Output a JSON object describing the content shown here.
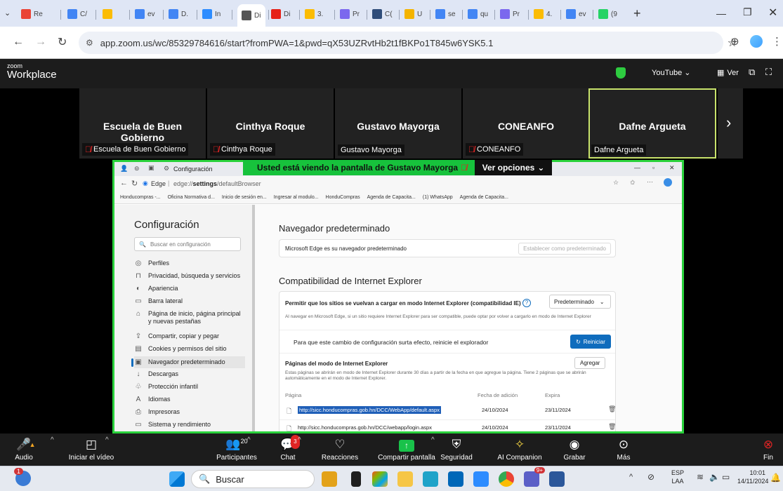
{
  "browser": {
    "tabs": [
      {
        "label": "M",
        "text": "Re",
        "color": "#ea4335"
      },
      {
        "label": "",
        "text": "C/",
        "color": "#4285f4"
      },
      {
        "label": "2.",
        "text": "",
        "color": "#fbbc04"
      },
      {
        "label": "",
        "text": "ev",
        "color": "#4285f4"
      },
      {
        "label": "",
        "text": "D.",
        "color": "#4285f4"
      },
      {
        "label": "zm",
        "text": "In",
        "color": "#2d8cff"
      },
      {
        "label": "",
        "text": "Di",
        "color": "#555"
      },
      {
        "label": "",
        "text": "Di",
        "color": "#e62117"
      },
      {
        "label": "",
        "text": "3.",
        "color": "#fbbc04"
      },
      {
        "label": "",
        "text": "Pr",
        "color": "#7b68ee"
      },
      {
        "label": "",
        "text": "C(",
        "color": "#2f4d7a"
      },
      {
        "label": "",
        "text": "U",
        "color": "#f4b400"
      },
      {
        "label": "G",
        "text": "se",
        "color": "#4285f4"
      },
      {
        "label": "G",
        "text": "qu",
        "color": "#4285f4"
      },
      {
        "label": "",
        "text": "Pr",
        "color": "#7b68ee"
      },
      {
        "label": "",
        "text": "4.",
        "color": "#fbbc04"
      },
      {
        "label": "",
        "text": "ev",
        "color": "#4285f4"
      },
      {
        "label": "",
        "text": "(9",
        "color": "#25d366"
      }
    ],
    "active_tab_close": "×",
    "new_tab": "+",
    "url": "app.zoom.us/wc/85329784616/start?fromPWA=1&pwd=qX53UZRvtHb2t1fBKPo1T845w6YSK5.1"
  },
  "zoom": {
    "logo_small": "zoom",
    "logo_big": "Workplace",
    "youtube_label": "YouTube",
    "view_label": "Ver",
    "participants": [
      {
        "name": "Escuela de Buen Gobierno",
        "label": "Escuela de Buen Gobierno",
        "muted": true
      },
      {
        "name": "Cinthya Roque",
        "label": "Cinthya Roque",
        "muted": true
      },
      {
        "name": "Gustavo Mayorga",
        "label": "Gustavo Mayorga",
        "muted": false
      },
      {
        "name": "CONEANFO",
        "label": "CONEANFO",
        "muted": true
      },
      {
        "name": "Dafne Argueta",
        "label": "Dafne Argueta",
        "muted": false
      }
    ],
    "banner_text": "Usted está viendo la pantalla de  Gustavo Mayorga",
    "view_options": "Ver opciones",
    "toolbar": {
      "audio": "Audio",
      "video": "Iniciar el vídeo",
      "participants": "Participantes",
      "participants_count": "20",
      "chat": "Chat",
      "chat_badge": "3",
      "reactions": "Reacciones",
      "share": "Compartir pantalla",
      "security": "Seguridad",
      "ai": "AI Companion",
      "record": "Grabar",
      "more": "Más",
      "end": "Fin"
    }
  },
  "shared_screen": {
    "window_title": "Configuración",
    "edge_label": "Edge",
    "edge_url_prefix": "edge://",
    "edge_url_bold": "settings",
    "edge_url_suffix": "/defaultBrowser",
    "bookmarks": [
      "Honducompras -...",
      "Oficina Normativa d...",
      "Inicio de sesión en...",
      "Ingresar al modulo...",
      "HonduCompras",
      "Agenda de Capacita...",
      "(1) WhatsApp",
      "Agenda de Capacita..."
    ],
    "sidebar_title": "Configuración",
    "search_placeholder": "Buscar en configuración",
    "sidebar_items": [
      "Perfiles",
      "Privacidad, búsqueda y servicios",
      "Apariencia",
      "Barra lateral",
      "Página de inicio, página principal y nuevas pestañas",
      "Compartir, copiar y pegar",
      "Cookies y permisos del sitio",
      "Navegador predeterminado",
      "Descargas",
      "Protección infantil",
      "Idiomas",
      "Impresoras",
      "Sistema y rendimiento"
    ],
    "default_title": "Navegador predeterminado",
    "default_text": "Microsoft Edge es su navegador predeterminado",
    "default_button": "Establecer como predeterminado",
    "ie_title": "Compatibilidad de Internet Explorer",
    "ie_allow": "Permitir que los sitios se vuelvan a cargar en modo Internet Explorer (compatibilidad IE)",
    "ie_allow_desc": "Al navegar en Microsoft Edge, si un sitio requiere Internet Explorer para ser compatible, puede optar por volver a cargarlo en modo de Internet Explorer",
    "ie_select": "Predeterminado",
    "restart_text": "Para que este cambio de configuración surta efecto, reinicie el explorador",
    "restart_button": "Reiniciar",
    "pages_title": "Páginas del modo de Internet Explorer",
    "pages_desc": "Estas páginas se abrirán en modo de Internet Explorer durante 30 días a partir de la fecha en que agregue la página. Tiene 2 páginas que se abrirán automáticamente en el modo de Internet Explorer.",
    "add_button": "Agregar",
    "col_page": "Página",
    "col_date": "Fecha de adición",
    "col_expires": "Expira",
    "rows": [
      {
        "url": "http://sicc.honducompras.gob.hn/DCC/WebApp/default.aspx",
        "date": "24/10/2024",
        "expires": "23/11/2024"
      },
      {
        "url": "http://sicc.honducompras.gob.hn/DCC/webapp/login.aspx",
        "date": "24/10/2024",
        "expires": "23/11/2024"
      }
    ]
  },
  "taskbar": {
    "search": "Buscar",
    "lang_top": "ESP",
    "lang_bottom": "LAA",
    "time": "10:01",
    "date": "14/11/2024",
    "notif_badge": "1",
    "teams_badge": "9+"
  }
}
